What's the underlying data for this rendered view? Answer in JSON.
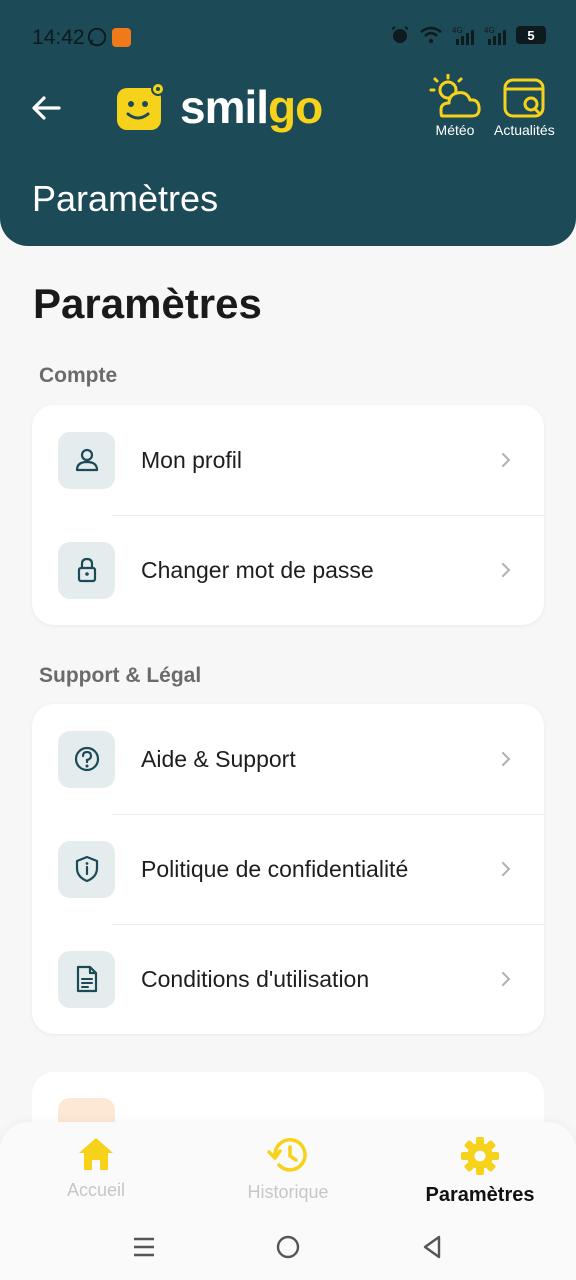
{
  "status_bar": {
    "time": "14:42",
    "battery": "5"
  },
  "header": {
    "logo_text_part1": "smil",
    "logo_text_part2": "go",
    "title": "Paramètres",
    "meteo_label": "Météo",
    "actu_label": "Actualités"
  },
  "page": {
    "title": "Paramètres"
  },
  "sections": {
    "account": {
      "label": "Compte",
      "items": [
        {
          "label": "Mon profil",
          "icon": "user-icon"
        },
        {
          "label": "Changer mot de passe",
          "icon": "lock-icon"
        }
      ]
    },
    "support": {
      "label": "Support & Légal",
      "items": [
        {
          "label": "Aide & Support",
          "icon": "help-icon"
        },
        {
          "label": "Politique de confidentialité",
          "icon": "shield-icon"
        },
        {
          "label": "Conditions d'utilisation",
          "icon": "document-icon"
        }
      ]
    }
  },
  "bottom_nav": {
    "items": [
      {
        "label": "Accueil",
        "icon": "home-icon",
        "active": false
      },
      {
        "label": "Historique",
        "icon": "history-icon",
        "active": false
      },
      {
        "label": "Paramètres",
        "icon": "gear-icon",
        "active": true
      }
    ]
  },
  "colors": {
    "header_bg": "#1c4a57",
    "accent_yellow": "#f6d21a",
    "icon_bg": "#e4ecee",
    "danger_orange": "#f07a1a"
  }
}
